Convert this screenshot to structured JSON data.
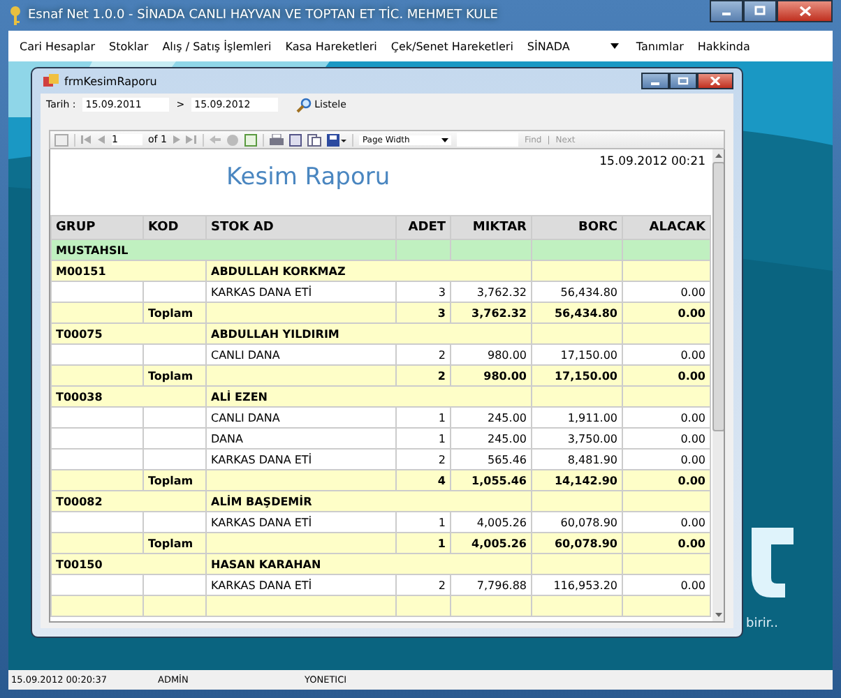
{
  "window": {
    "title": "Esnaf Net 1.0.0 - SİNADA CANLI HAYVAN VE TOPTAN ET TİC. MEHMET KULE"
  },
  "menu": {
    "items": [
      "Cari Hesaplar",
      "Stoklar",
      "Alış / Satış İşlemleri",
      "Kasa Hareketleri",
      "Çek/Senet Hareketleri"
    ],
    "combo": "SİNADA",
    "items_after": [
      "Tanımlar",
      "Hakkinda"
    ]
  },
  "background": {
    "slogan": "birir.."
  },
  "child_window": {
    "title": "frmKesimRaporu",
    "filter": {
      "label": "Tarih :",
      "from": "15.09.2011",
      "separator": ">",
      "to": "15.09.2012",
      "button": "Listele"
    },
    "viewer_toolbar": {
      "page": "1",
      "of": "of 1",
      "zoom": "Page Width",
      "find": "Find",
      "separator": "|",
      "next": "Next"
    },
    "report": {
      "title": "Kesim Raporu",
      "date": "15.09.2012 00:21",
      "columns": [
        "GRUP",
        "KOD",
        "STOK AD",
        "ADET",
        "MIKTAR",
        "BORC",
        "ALACAK"
      ],
      "rows": [
        {
          "kind": "section",
          "section": "MUSTAHSIL"
        },
        {
          "kind": "group",
          "code": "M00151",
          "name": "ABDULLAH KORKMAZ"
        },
        {
          "kind": "item",
          "stock": "KARKAS DANA ETİ",
          "adet": "3",
          "miktar": "3,762.32",
          "borc": "56,434.80",
          "alacak": "0.00"
        },
        {
          "kind": "total",
          "label": "Toplam",
          "adet": "3",
          "miktar": "3,762.32",
          "borc": "56,434.80",
          "alacak": "0.00"
        },
        {
          "kind": "group",
          "code": "T00075",
          "name": "ABDULLAH YILDIRIM"
        },
        {
          "kind": "item",
          "stock": "CANLI DANA",
          "adet": "2",
          "miktar": "980.00",
          "borc": "17,150.00",
          "alacak": "0.00"
        },
        {
          "kind": "total",
          "label": "Toplam",
          "adet": "2",
          "miktar": "980.00",
          "borc": "17,150.00",
          "alacak": "0.00"
        },
        {
          "kind": "group",
          "code": "T00038",
          "name": "ALİ EZEN"
        },
        {
          "kind": "item",
          "stock": "CANLI DANA",
          "adet": "1",
          "miktar": "245.00",
          "borc": "1,911.00",
          "alacak": "0.00"
        },
        {
          "kind": "item",
          "stock": "DANA",
          "adet": "1",
          "miktar": "245.00",
          "borc": "3,750.00",
          "alacak": "0.00"
        },
        {
          "kind": "item",
          "stock": "KARKAS DANA ETİ",
          "adet": "2",
          "miktar": "565.46",
          "borc": "8,481.90",
          "alacak": "0.00"
        },
        {
          "kind": "total",
          "label": "Toplam",
          "adet": "4",
          "miktar": "1,055.46",
          "borc": "14,142.90",
          "alacak": "0.00"
        },
        {
          "kind": "group",
          "code": "T00082",
          "name": "ALİM BAŞDEMİR"
        },
        {
          "kind": "item",
          "stock": "KARKAS DANA ETİ",
          "adet": "1",
          "miktar": "4,005.26",
          "borc": "60,078.90",
          "alacak": "0.00"
        },
        {
          "kind": "total",
          "label": "Toplam",
          "adet": "1",
          "miktar": "4,005.26",
          "borc": "60,078.90",
          "alacak": "0.00"
        },
        {
          "kind": "group",
          "code": "T00150",
          "name": "HASAN KARAHAN"
        },
        {
          "kind": "item",
          "stock": "KARKAS DANA ETİ",
          "adet": "2",
          "miktar": "7,796.88",
          "borc": "116,953.20",
          "alacak": "0.00"
        },
        {
          "kind": "total"
        }
      ]
    }
  },
  "status_bar": [
    "15.09.2012 00:20:37",
    "ADMİN",
    "YONETICI"
  ]
}
